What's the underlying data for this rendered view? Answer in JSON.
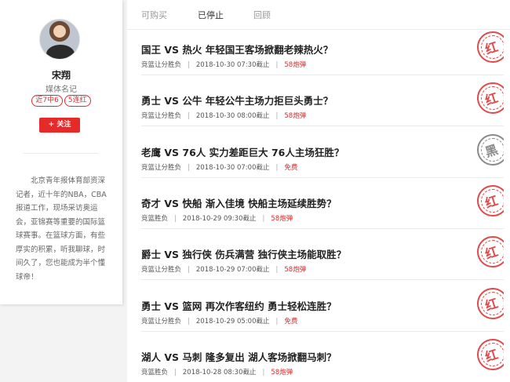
{
  "profile": {
    "name": "宋翔",
    "title": "媒体名记",
    "badges": [
      "近7中6",
      "5连红"
    ],
    "follow_label": "+ 关注",
    "bio": "北京青年报体育部资深记者，近十年的NBA，CBA报道工作，现场采访奥运会，亚锦赛等重要的国际篮球赛事。在篮球方面，有些厚实的积累，听我聊球，时间久了，您也能成为半个懂球帝！"
  },
  "tabs": [
    {
      "label": "可购买",
      "active": false
    },
    {
      "label": "已停止",
      "active": true
    },
    {
      "label": "回顾",
      "active": false
    }
  ],
  "articles": [
    {
      "title": "国王 VS 热火 年轻国王客场掀翻老辣热火？",
      "type": "竞篮让分胜负",
      "deadline": "2018-10-30 07:30截止",
      "price": "58炮弹",
      "result": "红"
    },
    {
      "title": "勇士 VS 公牛 年轻公牛主场力拒巨头勇士？",
      "type": "竞篮让分胜负",
      "deadline": "2018-10-30 08:00截止",
      "price": "58炮弹",
      "result": "红"
    },
    {
      "title": "老鹰 VS 76人 实力差距巨大 76人主场狂胜？",
      "type": "竞篮让分胜负",
      "deadline": "2018-10-30 07:00截止",
      "price": "免费",
      "result": "黑"
    },
    {
      "title": "奇才 VS 快船 渐入佳境 快船主场延续胜势？",
      "type": "竞篮胜负",
      "deadline": "2018-10-29 09:30截止",
      "price": "58炮弹",
      "result": "红"
    },
    {
      "title": "爵士 VS 独行侠 伤兵满营 独行侠主场能取胜？",
      "type": "竞篮让分胜负",
      "deadline": "2018-10-29 07:00截止",
      "price": "58炮弹",
      "result": "红"
    },
    {
      "title": "勇士 VS 篮网 再次作客纽约 勇士轻松连胜？",
      "type": "竞篮让分胜负",
      "deadline": "2018-10-29 05:00截止",
      "price": "免费",
      "result": "红"
    },
    {
      "title": "湖人 VS 马刺 隆多复出 湖人客场掀翻马刺？",
      "type": "竞篮胜负",
      "deadline": "2018-10-28 08:30截止",
      "price": "58炮弹",
      "result": "红"
    }
  ],
  "colors": {
    "accent": "#e52a2a",
    "stamp_red": "#e24a4a",
    "stamp_black": "#8a8a8a"
  }
}
